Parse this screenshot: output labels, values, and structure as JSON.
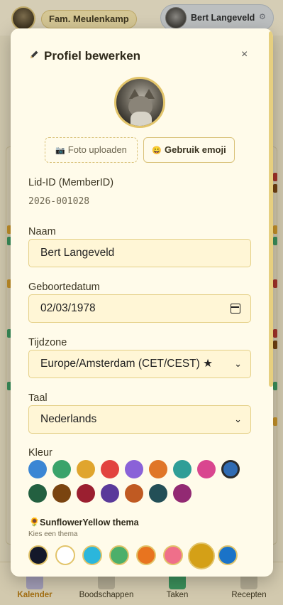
{
  "header": {
    "family_label": "Fam. Meulenkamp",
    "user_name": "Bert Langeveld",
    "gear_icon": "gear-icon"
  },
  "bottom_nav": [
    {
      "label": "Kalender",
      "icon": "calendar-grid-icon",
      "active": true
    },
    {
      "label": "Boodschappen",
      "icon": "cart-icon",
      "active": false
    },
    {
      "label": "Taken",
      "icon": "checkbox-icon",
      "active": false
    },
    {
      "label": "Recepten",
      "icon": "recipe-icon",
      "active": false
    }
  ],
  "modal": {
    "title": "Profiel bewerken",
    "close_symbol": "×",
    "upload_label": "Foto uploaden",
    "upload_icon": "📷",
    "emoji_label": "Gebruik emoji",
    "emoji_icon": "😀",
    "member_id_label": "Lid-ID (MemberID)",
    "member_id_value": "2026-001028",
    "name_label": "Naam",
    "name_value": "Bert Langeveld",
    "birthdate_label": "Geboortedatum",
    "birthdate_value": "02/03/1978",
    "timezone_label": "Tijdzone",
    "timezone_value": "Europe/Amsterdam (CET/CEST) ★",
    "language_label": "Taal",
    "language_value": "Nederlands",
    "color_label": "Kleur",
    "colors_row1": [
      "#3a86d4",
      "#3aa36a",
      "#e0a52e",
      "#e2433f",
      "#8a62d8",
      "#e07628",
      "#2f9e97",
      "#d9468f",
      "#2f6bb3"
    ],
    "colors_row2": [
      "#236040",
      "#7a4410",
      "#9b1f30",
      "#5a3a9a",
      "#c05a22",
      "#234f57",
      "#922a73"
    ],
    "selected_color": "#2f6bb3",
    "theme_icon": "🌻",
    "theme_title": "SunflowerYellow thema",
    "theme_subtitle": "Kies een thema",
    "themes": [
      "#14182a",
      "#ffffff",
      "#2bb6dc",
      "#4caf6a",
      "#e8741f",
      "#ef6f8a",
      "#d4a017",
      "#1a73c8"
    ],
    "selected_theme": "#d4a017"
  }
}
